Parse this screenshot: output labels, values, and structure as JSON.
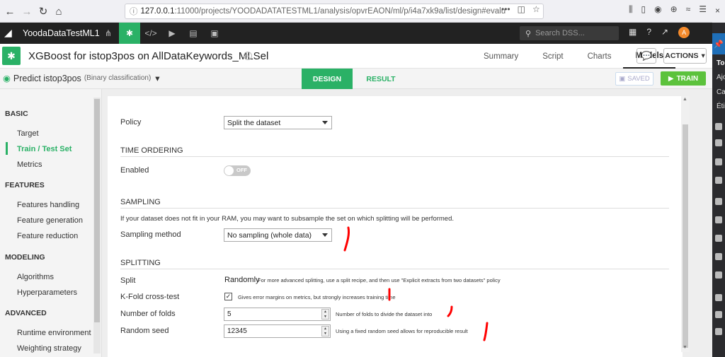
{
  "browser": {
    "url_host": "127.0.0.1",
    "url_path": ":11000/projects/YOODADATATESTML1/analysis/opvrEAON/ml/p/i4a7xk9a/list/design#evalu",
    "more": "•••"
  },
  "dss": {
    "project_name": "YoodaDataTestML1",
    "search_placeholder": "Search DSS...",
    "avatar_letter": "A"
  },
  "object": {
    "title": "XGBoost for istop3pos on AllDataKeywords_MLSel",
    "tabs": [
      "Summary",
      "Script",
      "Charts",
      "Models"
    ],
    "actions_label": "ACTIONS"
  },
  "subheader": {
    "predict_label": "Predict istop3pos",
    "predict_type": "(Binary classification)",
    "design_tab": "DESIGN",
    "result_tab": "RESULT",
    "saved_label": "SAVED",
    "train_label": "TRAIN"
  },
  "sidebar": {
    "sections": [
      {
        "title": "BASIC",
        "items": [
          "Target",
          "Train / Test Set",
          "Metrics"
        ]
      },
      {
        "title": "FEATURES",
        "items": [
          "Features handling",
          "Feature generation",
          "Feature reduction"
        ]
      },
      {
        "title": "MODELING",
        "items": [
          "Algorithms",
          "Hyperparameters"
        ]
      },
      {
        "title": "ADVANCED",
        "items": [
          "Runtime environment",
          "Weighting strategy"
        ]
      }
    ]
  },
  "side_strip": {
    "labels": [
      "To",
      "Ajo",
      "Ca",
      "Éti"
    ]
  },
  "form": {
    "policy_label": "Policy",
    "policy_value": "Split the dataset",
    "time_ordering_title": "TIME ORDERING",
    "enabled_label": "Enabled",
    "toggle_off": "OFF",
    "sampling_title": "SAMPLING",
    "sampling_info": "If your dataset does not fit in your RAM, you may want to subsample the set on which splitting will be performed.",
    "sampling_method_label": "Sampling method",
    "sampling_method_value": "No sampling (whole data)",
    "splitting_title": "SPLITTING",
    "split_label": "Split",
    "split_value": "Randomly",
    "split_help": "For more advanced splitting, use a split recipe, and then use \"Explicit extracts from two datasets\" policy",
    "kfold_label": "K-Fold cross-test",
    "kfold_help": "Gives error margins on metrics, but strongly increases training time",
    "kfold_checked": "✓",
    "folds_label": "Number of folds",
    "folds_value": "5",
    "folds_help": "Number of folds to divide the dataset into",
    "seed_label": "Random seed",
    "seed_value": "12345",
    "seed_help": "Using a fixed random seed allows for reproducible result"
  },
  "colors": {
    "accent": "#2ab166",
    "train": "#5cc23c",
    "annotation": "#ff0000"
  }
}
